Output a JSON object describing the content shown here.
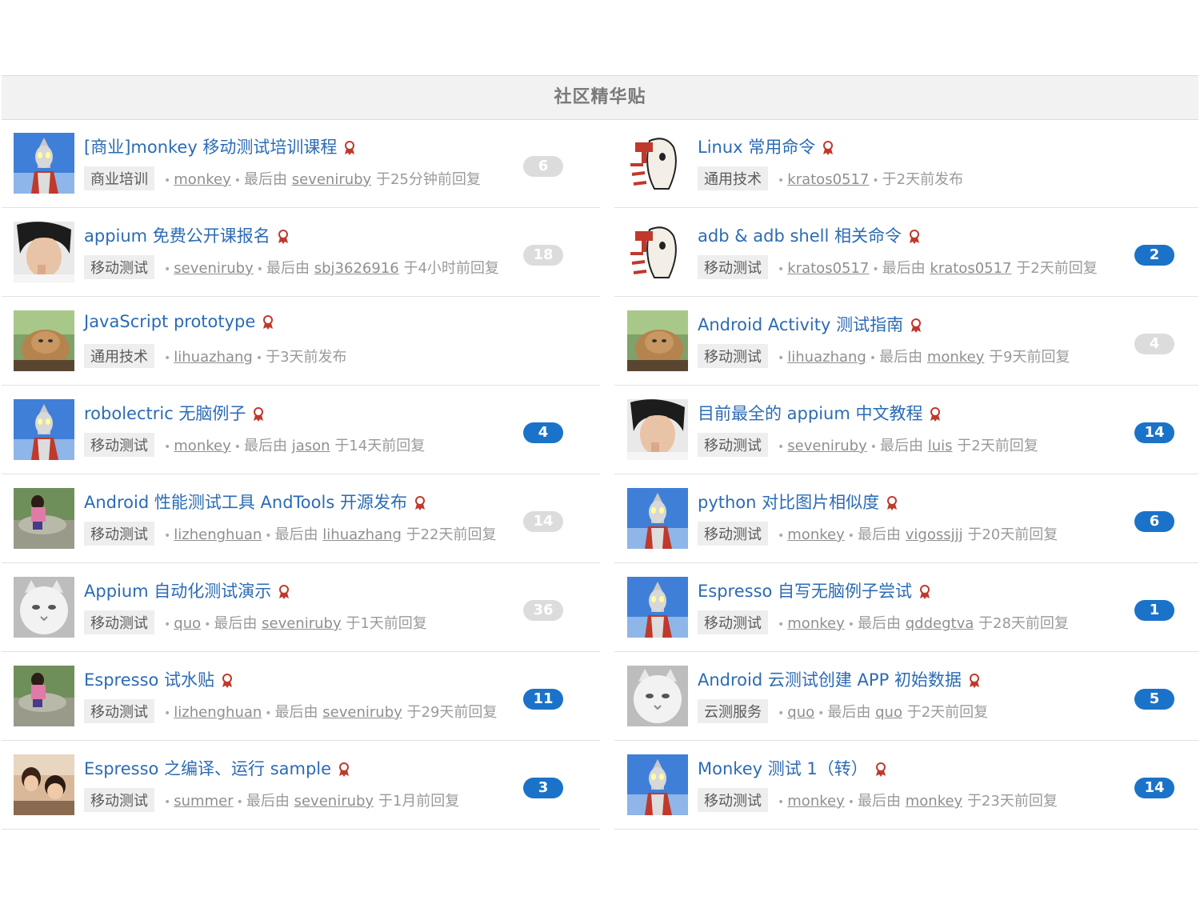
{
  "panel": {
    "title": "社区精华贴"
  },
  "colors": {
    "link": "#2b6bb5",
    "count_active": "#1a73c8",
    "count_read": "#dcdcdc",
    "badge": "#c0392b"
  },
  "meta_labels": {
    "last_reply_by": "最后由"
  },
  "topics": [
    {
      "column": "left",
      "title": "[商业]monkey 移动测试培训课程",
      "node": "商业培训",
      "author": "monkey",
      "last_reply_user": "seveniruby",
      "time": "于25分钟前回复",
      "count": "6",
      "count_state": "read",
      "avatar": "ultraman"
    },
    {
      "column": "right",
      "title": "Linux 常用命令",
      "node": "通用技术",
      "author": "kratos0517",
      "last_reply_user": "",
      "time": "于2天前发布",
      "count": "",
      "count_state": "none",
      "avatar": "cartoon"
    },
    {
      "column": "left",
      "title": "appium 免费公开课报名",
      "node": "移动测试",
      "author": "seveniruby",
      "last_reply_user": "sbj3626916",
      "time": "于4小时前回复",
      "count": "18",
      "count_state": "read",
      "avatar": "man"
    },
    {
      "column": "right",
      "title": "adb & adb shell 相关命令",
      "node": "移动测试",
      "author": "kratos0517",
      "last_reply_user": "kratos0517",
      "time": "于2天前回复",
      "count": "2",
      "count_state": "active",
      "avatar": "cartoon"
    },
    {
      "column": "left",
      "title": "JavaScript prototype",
      "node": "通用技术",
      "author": "lihuazhang",
      "last_reply_user": "",
      "time": "于3天前发布",
      "count": "",
      "count_state": "none",
      "avatar": "cat"
    },
    {
      "column": "right",
      "title": "Android Activity 测试指南",
      "node": "移动测试",
      "author": "lihuazhang",
      "last_reply_user": "monkey",
      "time": "于9天前回复",
      "count": "4",
      "count_state": "read",
      "avatar": "cat"
    },
    {
      "column": "left",
      "title": "robolectric 无脑例子",
      "node": "移动测试",
      "author": "monkey",
      "last_reply_user": "jason",
      "time": "于14天前回复",
      "count": "4",
      "count_state": "active",
      "avatar": "ultraman"
    },
    {
      "column": "right",
      "title": "目前最全的 appium 中文教程",
      "node": "移动测试",
      "author": "seveniruby",
      "last_reply_user": "luis",
      "time": "于2天前回复",
      "count": "14",
      "count_state": "active",
      "avatar": "man"
    },
    {
      "column": "left",
      "title": "Android 性能测试工具 AndTools 开源发布",
      "node": "移动测试",
      "author": "lizhenghuan",
      "last_reply_user": "lihuazhang",
      "time": "于22天前回复",
      "count": "14",
      "count_state": "read",
      "avatar": "girl"
    },
    {
      "column": "right",
      "title": "python 对比图片相似度",
      "node": "移动测试",
      "author": "monkey",
      "last_reply_user": "vigossjjj",
      "time": "于20天前回复",
      "count": "6",
      "count_state": "active",
      "avatar": "ultraman"
    },
    {
      "column": "left",
      "title": "Appium 自动化测试演示",
      "node": "移动测试",
      "author": "quo",
      "last_reply_user": "seveniruby",
      "time": "于1天前回复",
      "count": "36",
      "count_state": "read",
      "avatar": "whitecat"
    },
    {
      "column": "right",
      "title": "Espresso 自写无脑例子尝试",
      "node": "移动测试",
      "author": "monkey",
      "last_reply_user": "qddegtva",
      "time": "于28天前回复",
      "count": "1",
      "count_state": "active",
      "avatar": "ultraman"
    },
    {
      "column": "left",
      "title": "Espresso 试水贴",
      "node": "移动测试",
      "author": "lizhenghuan",
      "last_reply_user": "seveniruby",
      "time": "于29天前回复",
      "count": "11",
      "count_state": "active",
      "avatar": "girl"
    },
    {
      "column": "right",
      "title": "Android 云测试创建 APP 初始数据",
      "node": "云测服务",
      "author": "quo",
      "last_reply_user": "quo",
      "time": "于2天前回复",
      "count": "5",
      "count_state": "active",
      "avatar": "whitecat"
    },
    {
      "column": "left",
      "title": "Espresso 之编译、运行 sample",
      "node": "移动测试",
      "author": "summer",
      "last_reply_user": "seveniruby",
      "time": "于1月前回复",
      "count": "3",
      "count_state": "active",
      "avatar": "couple"
    },
    {
      "column": "right",
      "title": "Monkey 测试 1（转）",
      "node": "移动测试",
      "author": "monkey",
      "last_reply_user": "monkey",
      "time": "于23天前回复",
      "count": "14",
      "count_state": "active",
      "avatar": "ultraman"
    }
  ]
}
